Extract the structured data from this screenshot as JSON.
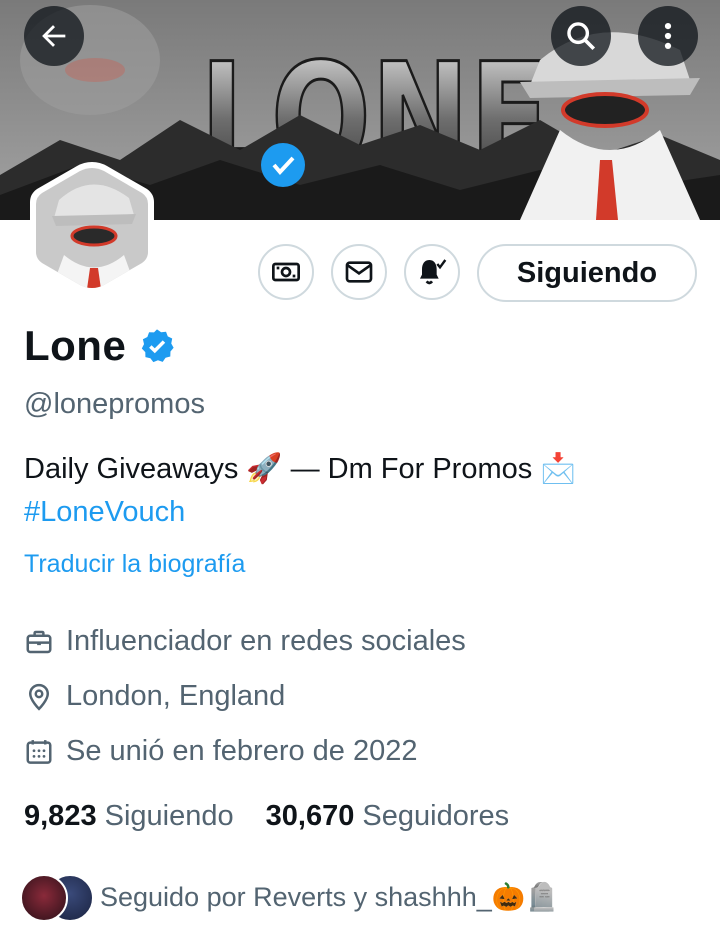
{
  "banner": {
    "title_art": "LONE"
  },
  "header": {
    "back_icon": "arrow-left-icon",
    "search_icon": "search-icon",
    "more_icon": "more-vertical-icon"
  },
  "actions": {
    "subscribe_icon": "money-icon",
    "message_icon": "envelope-icon",
    "notify_icon": "bell-check-icon",
    "follow_label": "Siguiendo"
  },
  "profile": {
    "name": "Lone",
    "handle": "@lonepromos",
    "bio_line1": "Daily Giveaways 🚀 — Dm For Promos 📩",
    "bio_hashtag": "#LoneVouch",
    "translate_label": "Traducir la biografía",
    "category": "Influenciador en redes sociales",
    "location": "London, England",
    "joined": "Se unió en febrero de 2022"
  },
  "stats": {
    "following_count": "9,823",
    "following_label": "Siguiendo",
    "followers_count": "30,670",
    "followers_label": "Seguidores"
  },
  "followed_by": {
    "text": "Seguido por Reverts y shashhh_🎃🪦"
  },
  "colors": {
    "accent": "#1d9bf0",
    "muted": "#536471",
    "border": "#cfd9de"
  }
}
